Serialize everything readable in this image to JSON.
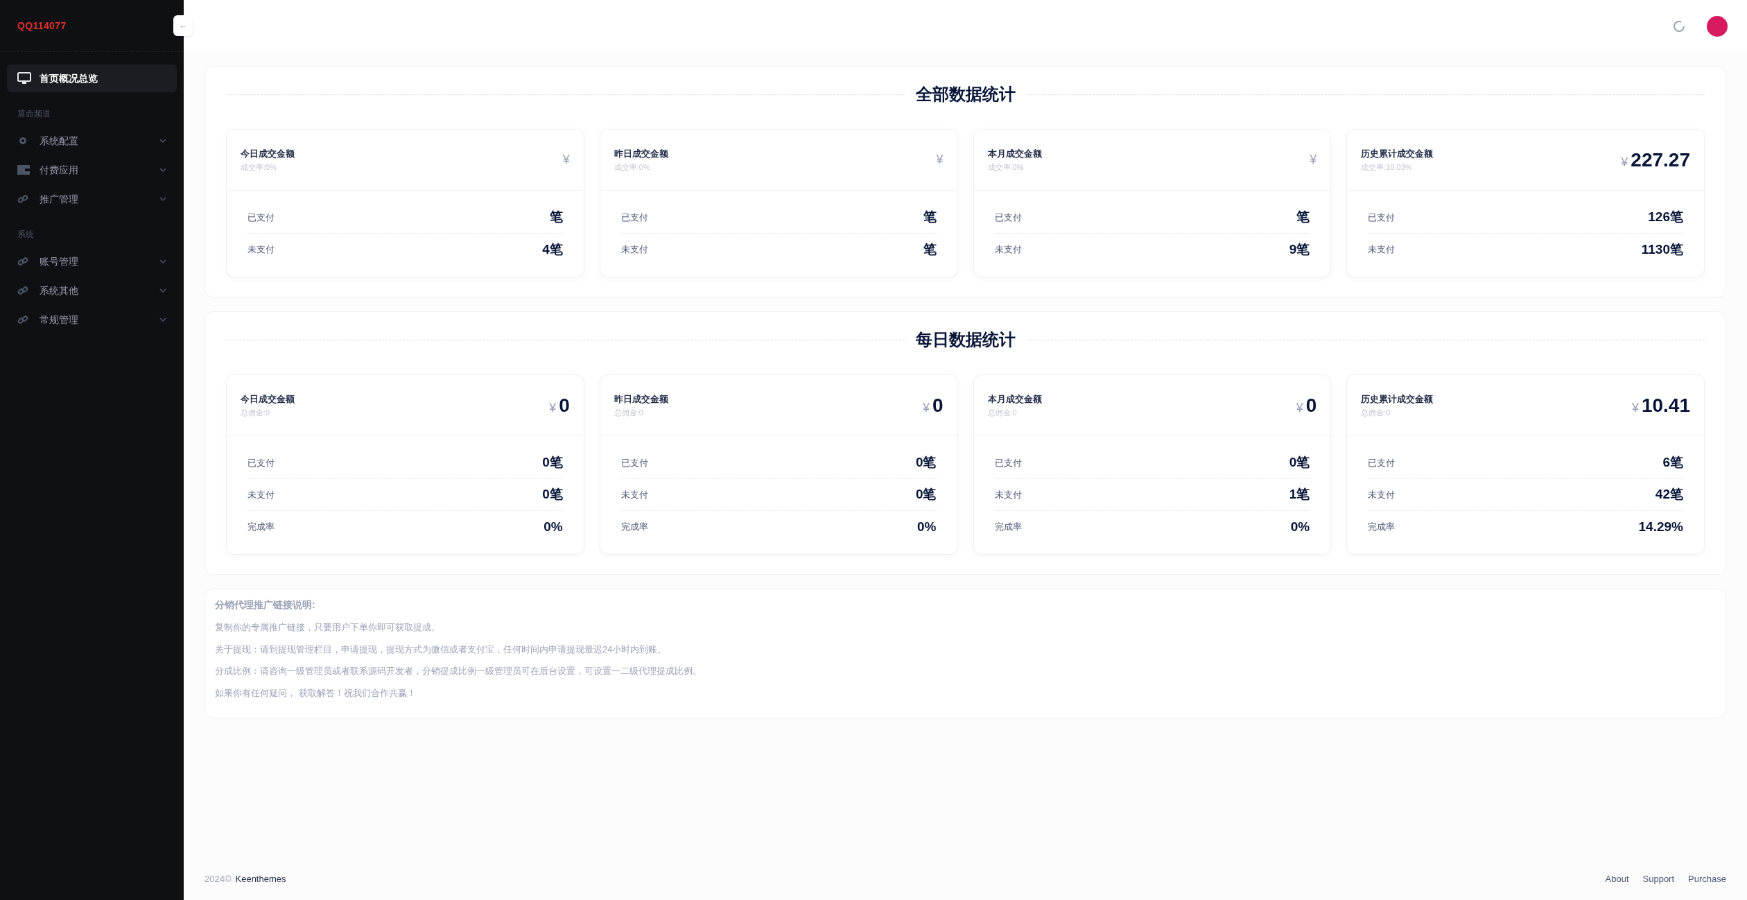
{
  "sidebar": {
    "logo": "QQ114077",
    "collapse_icon_text": "←",
    "groups": [
      {
        "items": [
          {
            "label": "首页概况总览",
            "kind": "monitor",
            "selected": true,
            "has_children": false
          }
        ]
      },
      {
        "heading": "算命频道",
        "items": [
          {
            "label": "系统配置",
            "kind": "gear",
            "selected": false,
            "has_children": true
          },
          {
            "label": "付费应用",
            "kind": "card",
            "selected": false,
            "has_children": true
          },
          {
            "label": "推广管理",
            "kind": "link",
            "selected": false,
            "has_children": true
          }
        ]
      },
      {
        "heading": "系统",
        "items": [
          {
            "label": "账号管理",
            "kind": "link",
            "selected": false,
            "has_children": true
          },
          {
            "label": "系统其他",
            "kind": "link",
            "selected": false,
            "has_children": true
          },
          {
            "label": "常规管理",
            "kind": "link",
            "selected": false,
            "has_children": true
          }
        ]
      }
    ]
  },
  "sections": [
    {
      "title": "全部数据统计",
      "cards": [
        {
          "title": "今日成交金额",
          "subtitle": "成交率:0%",
          "currency": "¥",
          "rows": [
            {
              "label": "已支付",
              "value": "笔"
            },
            {
              "label": "未支付",
              "value": "4笔"
            }
          ]
        },
        {
          "title": "昨日成交金额",
          "subtitle": "成交率:0%",
          "currency": "¥",
          "rows": [
            {
              "label": "已支付",
              "value": "笔"
            },
            {
              "label": "未支付",
              "value": "笔"
            }
          ]
        },
        {
          "title": "本月成交金额",
          "subtitle": "成交率:0%",
          "currency": "¥",
          "rows": [
            {
              "label": "已支付",
              "value": "笔"
            },
            {
              "label": "未支付",
              "value": "9笔"
            }
          ]
        },
        {
          "title": "历史累计成交金额",
          "subtitle": "成交率:10.03%",
          "currency": "¥",
          "amount": "227.27",
          "rows": [
            {
              "label": "已支付",
              "value": "126笔"
            },
            {
              "label": "未支付",
              "value": "1130笔"
            }
          ]
        }
      ]
    },
    {
      "title": "每日数据统计",
      "cards": [
        {
          "title": "今日成交金额",
          "subtitle": "总佣金:0",
          "currency": "¥",
          "amount": "0",
          "rows": [
            {
              "label": "已支付",
              "value": "0笔"
            },
            {
              "label": "未支付",
              "value": "0笔"
            },
            {
              "label": "完成率",
              "value": "0%"
            }
          ]
        },
        {
          "title": "昨日成交金额",
          "subtitle": "总佣金:0",
          "currency": "¥",
          "amount": "0",
          "rows": [
            {
              "label": "已支付",
              "value": "0笔"
            },
            {
              "label": "未支付",
              "value": "0笔"
            },
            {
              "label": "完成率",
              "value": "0%"
            }
          ]
        },
        {
          "title": "本月成交金额",
          "subtitle": "总佣金:0",
          "currency": "¥",
          "amount": "0",
          "rows": [
            {
              "label": "已支付",
              "value": "0笔"
            },
            {
              "label": "未支付",
              "value": "1笔"
            },
            {
              "label": "完成率",
              "value": "0%"
            }
          ]
        },
        {
          "title": "历史累计成交金额",
          "subtitle": "总佣金:0",
          "currency": "¥",
          "amount": "10.41",
          "rows": [
            {
              "label": "已支付",
              "value": "6笔"
            },
            {
              "label": "未支付",
              "value": "42笔"
            },
            {
              "label": "完成率",
              "value": "14.29%"
            }
          ]
        }
      ]
    }
  ],
  "notice": {
    "title": "分销代理推广链接说明:",
    "paragraphs": [
      "复制你的专属推广链接，只要用户下单你即可获取提成。",
      "关于提现：请到提现管理栏目，申请提现，提现方式为微信或者支付宝，任何时间内申请提现最迟24小时内到账。",
      "分成比例：请咨询一级管理员或者联系源码开发者，分销提成比例一级管理员可在后台设置，可设置一二级代理提成比例。",
      "如果你有任何疑问， 获取解答！祝我们合作共赢！"
    ]
  },
  "footer": {
    "year": "2024©",
    "brand": "Keenthemes",
    "links": [
      "About",
      "Support",
      "Purchase"
    ]
  }
}
